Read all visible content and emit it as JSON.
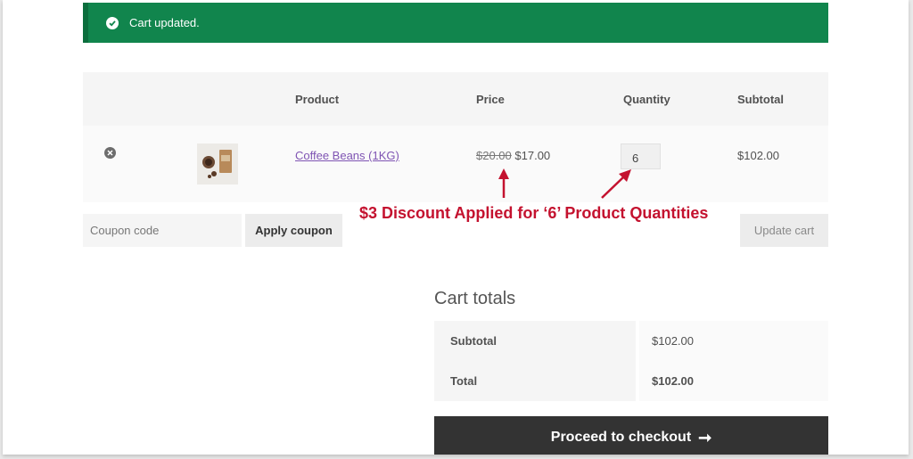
{
  "notice": {
    "message": "Cart updated.",
    "icon": "check-circle-icon",
    "color": "#11854d"
  },
  "cart": {
    "headers": {
      "product": "Product",
      "price": "Price",
      "quantity": "Quantity",
      "subtotal": "Subtotal"
    },
    "items": [
      {
        "name": "Coffee Beans (1KG)",
        "old_price": "$20.00",
        "price": "$17.00",
        "quantity": "6",
        "subtotal": "$102.00"
      }
    ]
  },
  "actions": {
    "coupon_placeholder": "Coupon code",
    "apply_label": "Apply coupon",
    "update_label": "Update cart"
  },
  "annotation": {
    "text": "$3 Discount Applied for ‘6’ Product Quantities",
    "color": "#c4122f"
  },
  "totals": {
    "title": "Cart totals",
    "subtotal_label": "Subtotal",
    "subtotal_value": "$102.00",
    "total_label": "Total",
    "total_value": "$102.00"
  },
  "checkout": {
    "label": "Proceed to checkout",
    "arrow": "➞"
  }
}
